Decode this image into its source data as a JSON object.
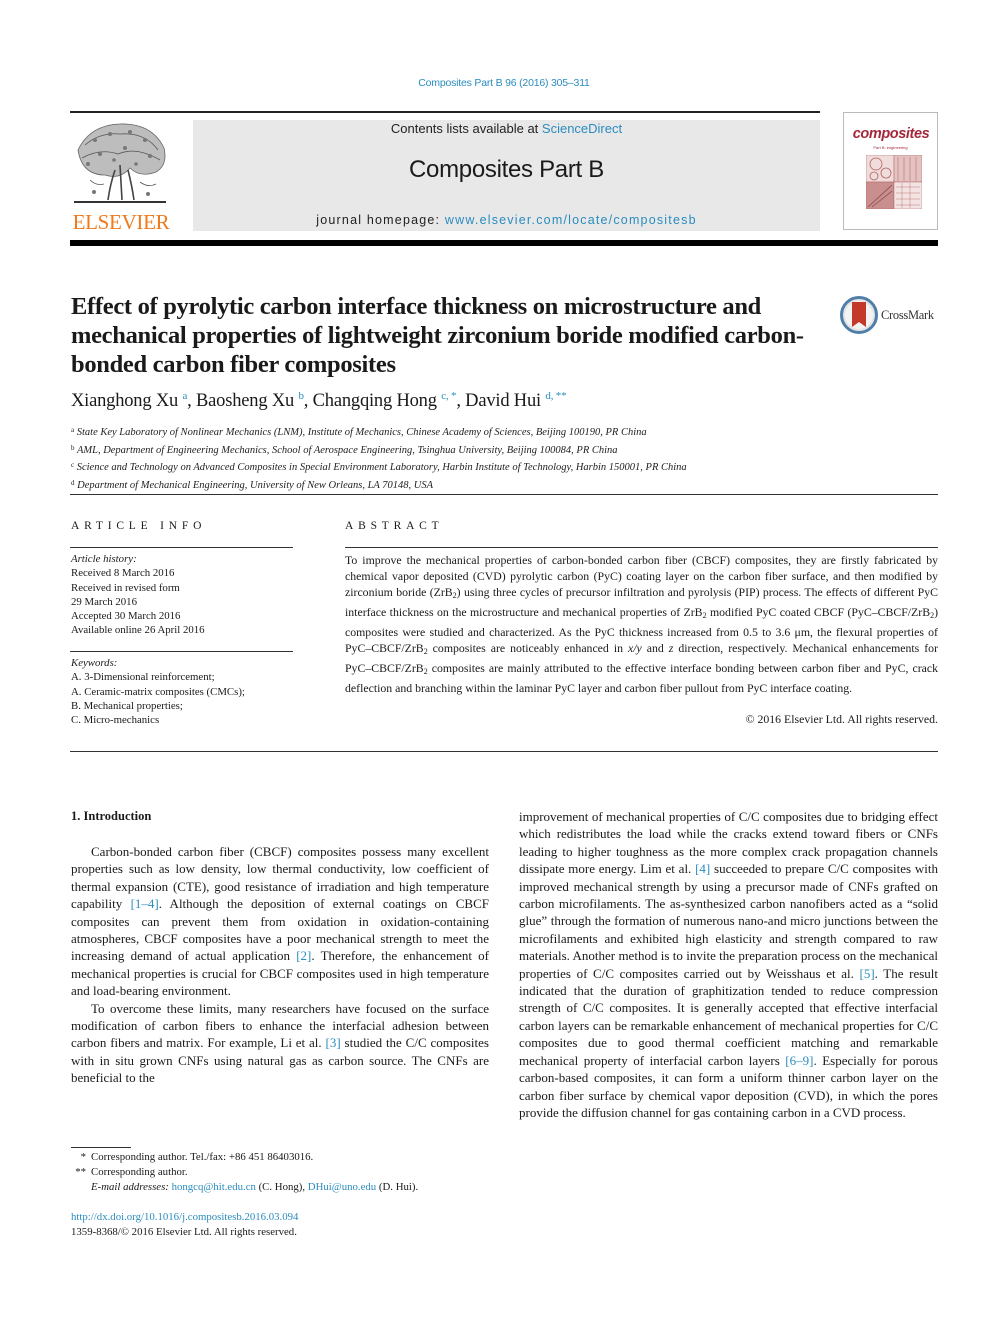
{
  "header": {
    "citation": "Composites Part B 96 (2016) 305–311",
    "contents_prefix": "Contents lists available at ",
    "contents_link": "ScienceDirect",
    "journal_name": "Composites Part B",
    "homepage_prefix": "journal homepage: ",
    "homepage_link": "www.elsevier.com/locate/compositesb",
    "publisher_logo_text": "ELSEVIER",
    "cover_title": "composites",
    "cover_subtitle": "Part B: engineering"
  },
  "article": {
    "title": "Effect of pyrolytic carbon interface thickness on microstructure and mechanical properties of lightweight zirconium boride modified carbon-bonded carbon fiber composites",
    "crossmark_label": "CrossMark",
    "authors": [
      {
        "name": "Xianghong Xu",
        "sup": "a"
      },
      {
        "name": "Baosheng Xu",
        "sup": "b"
      },
      {
        "name": "Changqing Hong",
        "sup": "c, *"
      },
      {
        "name": "David Hui",
        "sup": "d, **"
      }
    ],
    "affiliations": [
      {
        "mark": "a",
        "text": "State Key Laboratory of Nonlinear Mechanics (LNM), Institute of Mechanics, Chinese Academy of Sciences, Beijing 100190, PR China"
      },
      {
        "mark": "b",
        "text": "AML, Department of Engineering Mechanics, School of Aerospace Engineering, Tsinghua University, Beijing 100084, PR China"
      },
      {
        "mark": "c",
        "text": "Science and Technology on Advanced Composites in Special Environment Laboratory, Harbin Institute of Technology, Harbin 150001, PR China"
      },
      {
        "mark": "d",
        "text": "Department of Mechanical Engineering, University of New Orleans, LA 70148, USA"
      }
    ]
  },
  "article_info": {
    "heading": "ARTICLE INFO",
    "history_label": "Article history:",
    "history": [
      "Received 8 March 2016",
      "Received in revised form",
      "29 March 2016",
      "Accepted 30 March 2016",
      "Available online 26 April 2016"
    ],
    "keywords_label": "Keywords:",
    "keywords": [
      "A. 3-Dimensional reinforcement;",
      "A. Ceramic-matrix composites (CMCs);",
      "B. Mechanical properties;",
      "C. Micro-mechanics"
    ]
  },
  "abstract": {
    "heading": "ABSTRACT",
    "parts": {
      "p1": "To improve the mechanical properties of carbon-bonded carbon fiber (CBCF) composites, they are firstly fabricated by chemical vapor deposited (CVD) pyrolytic carbon (PyC) coating layer on the carbon fiber surface, and then modified by zirconium boride (ZrB",
      "p2": ") using three cycles of precursor infiltration and pyrolysis (PIP) process. The effects of different PyC interface thickness on the microstructure and mechanical properties of ZrB",
      "p3": " modified PyC coated CBCF (PyC–CBCF/ZrB",
      "p4": ") composites were studied and characterized. As the PyC thickness increased from 0.5 to 3.6 μm, the flexural properties of PyC–CBCF/ZrB",
      "p5": " composites are noticeably enhanced in ",
      "xy": "x/y",
      "p6": " and ",
      "z": "z",
      "p7": " direction, respectively. Mechanical enhancements for PyC–CBCF/ZrB",
      "p8": " composites are mainly attributed to the effective interface bonding between carbon fiber and PyC, crack deflection and branching within the laminar PyC layer and carbon fiber pullout from PyC interface coating.",
      "sub2": "2"
    },
    "copyright": "© 2016 Elsevier Ltd. All rights reserved."
  },
  "introduction": {
    "heading": "1.  Introduction",
    "left": {
      "para1_a": "Carbon-bonded carbon fiber (CBCF) composites possess many excellent properties such as low density, low thermal conductivity, low coefficient of thermal expansion (CTE), good resistance of irradiation and high temperature capability ",
      "ref_1_4": "[1–4]",
      "para1_b": ". Although the deposition of external coatings on CBCF composites can prevent them from oxidation in oxidation-containing atmospheres, CBCF composites have a poor mechanical strength to meet the increasing demand of actual application ",
      "ref_2": "[2]",
      "para1_c": ". Therefore, the enhancement of mechanical properties is crucial for CBCF composites used in high temperature and load-bearing environment.",
      "para2_a": "To overcome these limits, many researchers have focused on the surface modification of carbon fibers to enhance the interfacial adhesion between carbon fibers and matrix. For example, Li et al. ",
      "ref_3": "[3]",
      "para2_b": " studied the C/C composites with in situ grown CNFs using natural gas as carbon source. The CNFs are beneficial to the"
    },
    "right": {
      "a": "improvement of mechanical properties of C/C composites due to bridging effect which redistributes the load while the cracks extend toward fibers or CNFs leading to higher toughness as the more complex crack propagation channels dissipate more energy. Lim et al. ",
      "ref_4": "[4]",
      "b": " succeeded to prepare C/C composites with improved mechanical strength by using a precursor made of CNFs grafted on carbon microfilaments. The as-synthesized carbon nanofibers acted as a “solid glue” through the formation of numerous nano-and micro junctions between the microfilaments and exhibited high elasticity and strength compared to raw materials. Another method is to invite the preparation process on the mechanical properties of C/C composites carried out by Weisshaus et al. ",
      "ref_5": "[5]",
      "c": ". The result indicated that the duration of graphitization tended to reduce compression strength of C/C composites. It is generally accepted that effective interfacial carbon layers can be remarkable enhancement of mechanical properties for C/C composites due to good thermal coefficient matching and remarkable mechanical property of interfacial carbon layers ",
      "ref_6_9": "[6–9]",
      "d": ". Especially for porous carbon-based composites, it can form a uniform thinner carbon layer on the carbon fiber surface by chemical vapor deposition (CVD), in which the pores provide the diffusion channel for gas containing carbon in a CVD process."
    }
  },
  "footnotes": {
    "fn1_mark": "*",
    "fn1_text": "Corresponding author. Tel./fax: +86 451 86403016.",
    "fn2_mark": "**",
    "fn2_text": "Corresponding author.",
    "email_label": "E-mail addresses:",
    "email1": "hongcq@hit.edu.cn",
    "email1_name": " (C. Hong), ",
    "email2": "DHui@uno.edu",
    "email2_name": " (D. Hui).",
    "doi": "http://dx.doi.org/10.1016/j.compositesb.2016.03.094",
    "issn": "1359-8368/© 2016 Elsevier Ltd. All rights reserved."
  }
}
